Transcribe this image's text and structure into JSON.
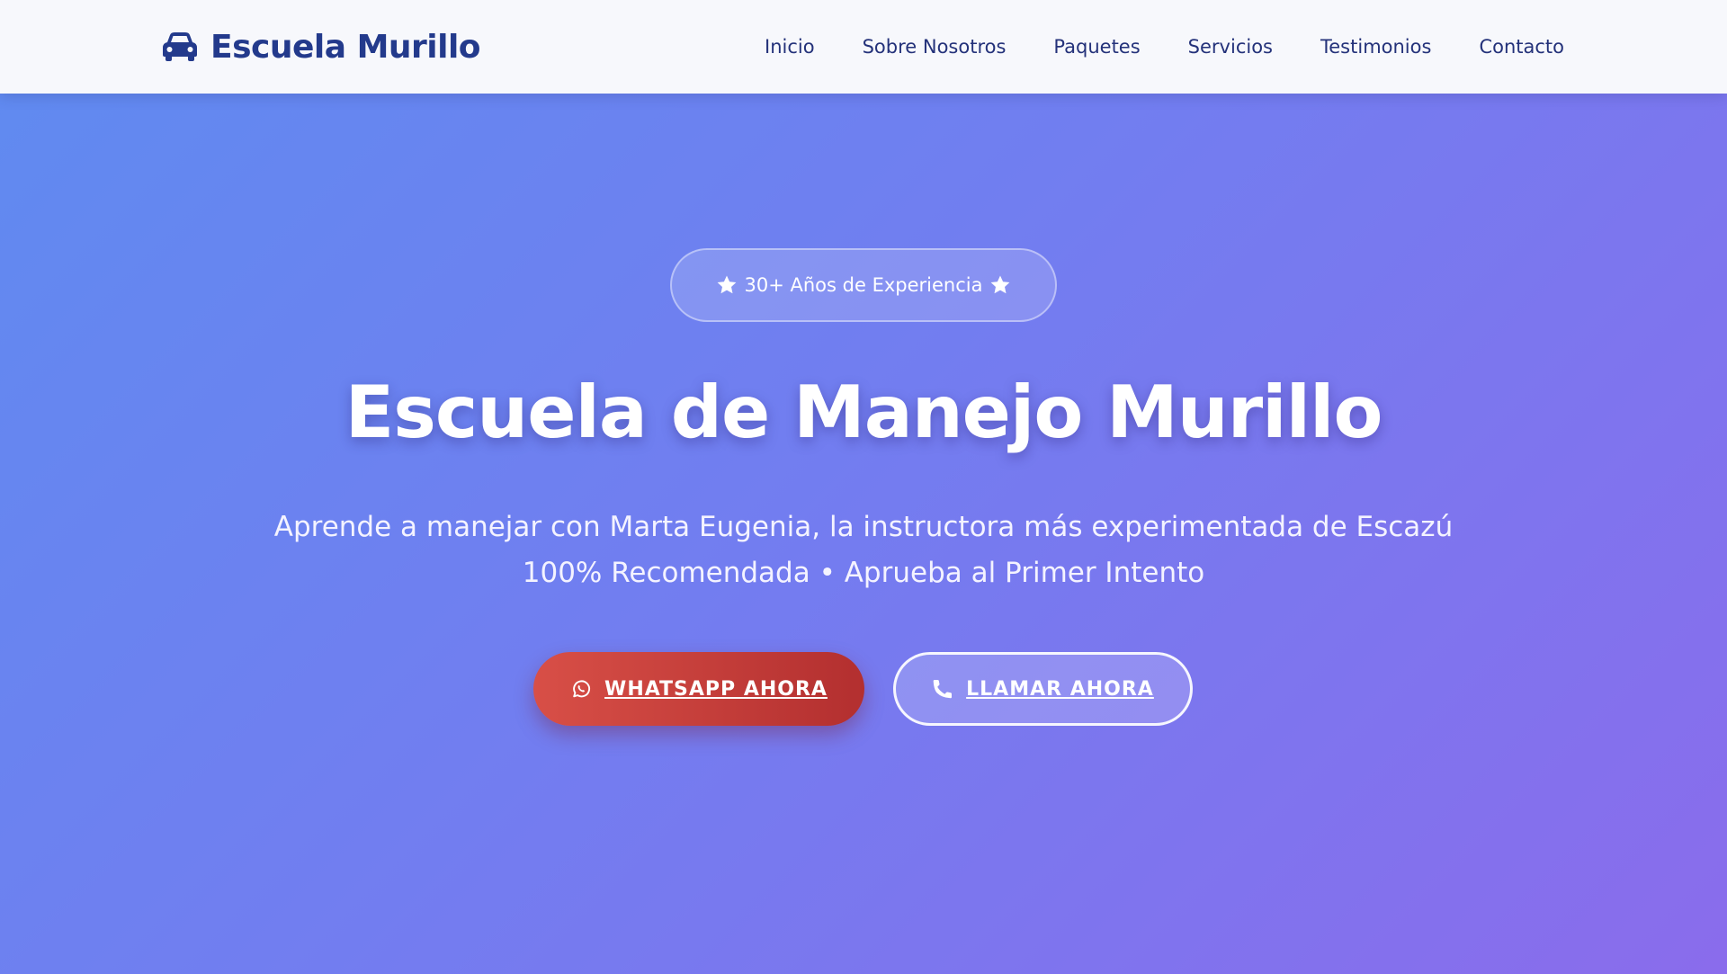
{
  "header": {
    "brand_icon": "car-icon",
    "brand_name": "Escuela Murillo",
    "nav": [
      "Inicio",
      "Sobre Nosotros",
      "Paquetes",
      "Servicios",
      "Testimonios",
      "Contacto"
    ]
  },
  "hero": {
    "badge": {
      "icon": "star-icon",
      "text": "30+ Años de Experiencia"
    },
    "title": "Escuela de Manejo Murillo",
    "subtitle_line1": "Aprende a manejar con Marta Eugenia, la instructora más experimentada de Escazú",
    "subtitle_line2": "100% Recomendada • Aprueba al Primer Intento",
    "buttons": {
      "whatsapp": {
        "label": "WHATSAPP AHORA",
        "icon": "whatsapp-icon"
      },
      "call": {
        "label": "LLAMAR AHORA",
        "icon": "phone-icon"
      }
    }
  },
  "colors": {
    "brand": "#233a8c",
    "header_bg": "#f7f8fc",
    "hero_gradient_start": "#5f8bf0",
    "hero_gradient_end": "#8a6cec",
    "whatsapp_button": "#c83e3a",
    "text_on_hero": "#ffffff"
  }
}
